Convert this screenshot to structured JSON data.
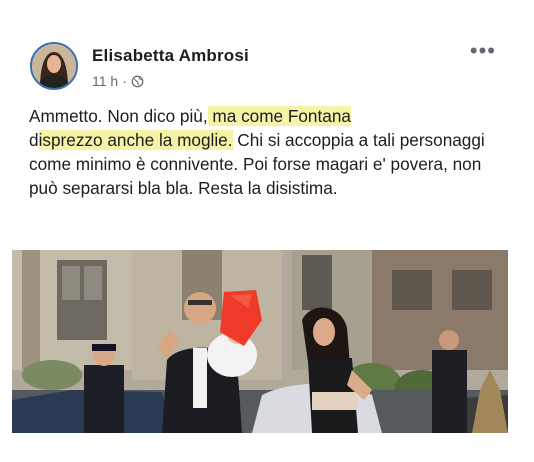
{
  "post": {
    "author": "Elisabetta Ambrosi",
    "time": "11 h",
    "separator": "·",
    "privacy_icon": "globe-icon",
    "more_label": "•••",
    "text": {
      "part1": "Ammetto. Non dico più,",
      "highlight1": " ma come Fontana",
      "part2": "d",
      "highlight2": "isprezzo anche la moglie.",
      "part3": " Chi si accoppia a tali personaggi come minimo è connivente. Poi forse magari e' povera, non può separarsi bla bla. Resta la disistima."
    },
    "highlight_color": "#f6f2a6",
    "photo_icon": "news-photo"
  }
}
